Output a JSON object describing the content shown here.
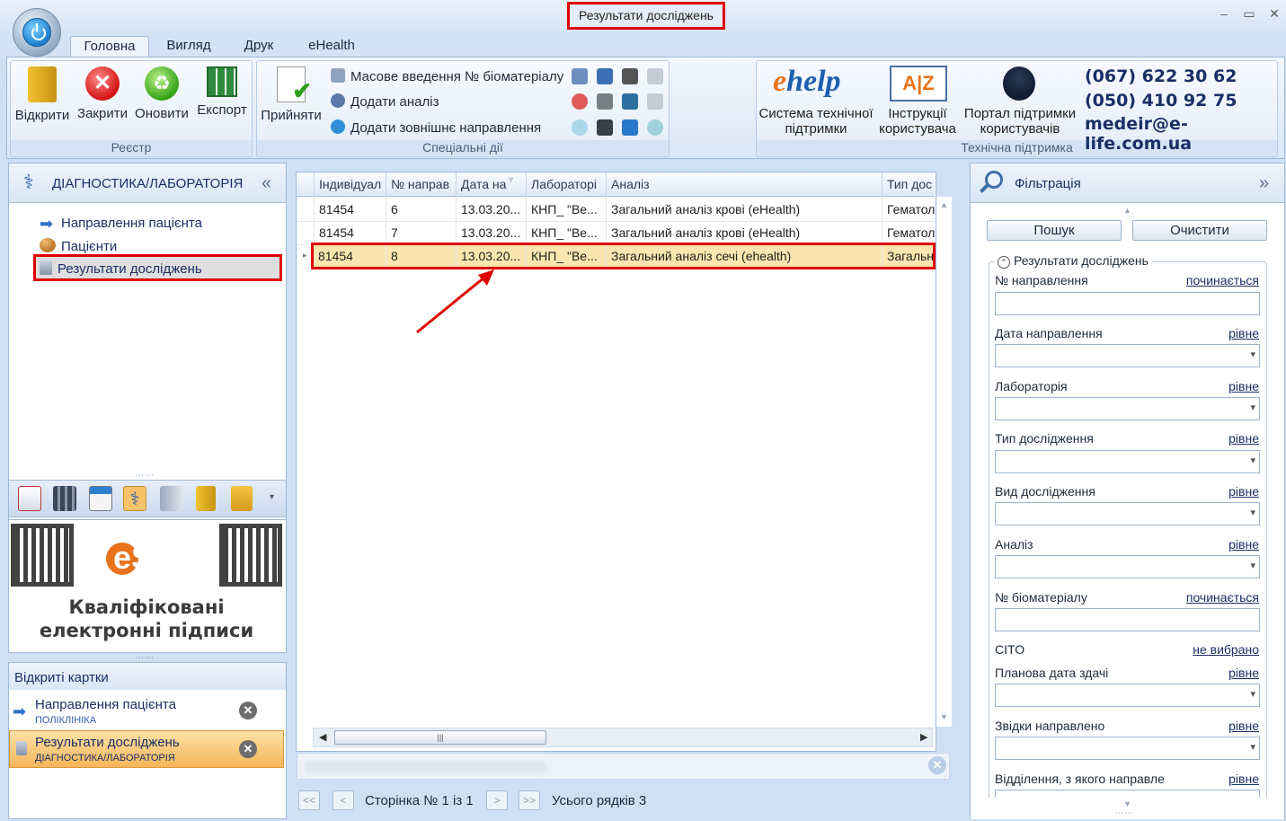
{
  "window": {
    "title": "Результати досліджень"
  },
  "tabs": [
    "Головна",
    "Вигляд",
    "Друк",
    "eHealth"
  ],
  "ribbon": {
    "registry": {
      "label": "Реєстр",
      "buttons": [
        "Відкрити",
        "Закрити",
        "Оновити",
        "Експорт"
      ]
    },
    "special": {
      "label": "Спеціальні дії",
      "accept": "Прийняти",
      "items": [
        "Масове введення № біоматеріалу",
        "Додати аналіз",
        "Додати зовнішнє направлення"
      ]
    },
    "support": {
      "label": "Технічна підтримка",
      "ehelp_logo": "ehelp",
      "buttons": [
        "Система технічної підтримки",
        "Інструкції користувача",
        "Портал підтримки користувачів"
      ],
      "phone1": "(067) 622 30 62",
      "phone2": "(050) 410 92 75",
      "email": "medeir@e-life.com.ua"
    }
  },
  "nav": {
    "title": "ДІАГНОСТИКА/ЛАБОРАТОРІЯ",
    "items": [
      "Направлення пацієнта",
      "Пацієнти",
      "Результати досліджень"
    ]
  },
  "esign": {
    "logo": "eSign",
    "line1": "Кваліфіковані",
    "line2": "електронні підписи"
  },
  "cards": {
    "title": "Відкриті картки",
    "items": [
      {
        "name": "Направлення пацієнта",
        "sub": "ПОЛІКЛІНІКА"
      },
      {
        "name": "Результати досліджень",
        "sub": "ДІАГНОСТИКА/ЛАБОРАТОРІЯ"
      }
    ]
  },
  "grid": {
    "columns": [
      "Індивідуал",
      "№ направ",
      "Дата на",
      "Лабораторі",
      "Аналіз",
      "Тип дос"
    ],
    "rows": [
      [
        "81454",
        "6",
        "13.03.20...",
        "КНП_ \"Ве...",
        "Загальний аналіз крові (eHealth)",
        "Гематол"
      ],
      [
        "81454",
        "7",
        "13.03.20...",
        "КНП_ \"Ве...",
        "Загальний аналіз крові (eHealth)",
        "Гематол"
      ],
      [
        "81454",
        "8",
        "13.03.20...",
        "КНП_ \"Ве...",
        "Загальний аналіз сечі (ehealth)",
        "Загальн"
      ]
    ],
    "selected_row": 2
  },
  "pager": {
    "page_text": "Сторінка № 1 із 1",
    "total_text": "Усього рядків 3"
  },
  "filter": {
    "title": "Фільтрація",
    "search": "Пошук",
    "clear": "Очистити",
    "group": "Результати досліджень",
    "fields": [
      {
        "label": "№ направлення",
        "op": "починається"
      },
      {
        "label": "Дата направлення",
        "op": "рівне"
      },
      {
        "label": "Лабораторія",
        "op": "рівне"
      },
      {
        "label": "Тип дослідження",
        "op": "рівне"
      },
      {
        "label": "Вид дослідження",
        "op": "рівне"
      },
      {
        "label": "Аналіз",
        "op": "рівне"
      },
      {
        "label": "№ біоматеріалу",
        "op": "починається"
      },
      {
        "label": "CITO",
        "op": "не вибрано"
      },
      {
        "label": "Планова дата здачі",
        "op": "рівне"
      },
      {
        "label": "Звідки направлено",
        "op": "рівне"
      },
      {
        "label": "Відділення, з якого направле",
        "op": "рівне"
      }
    ]
  }
}
